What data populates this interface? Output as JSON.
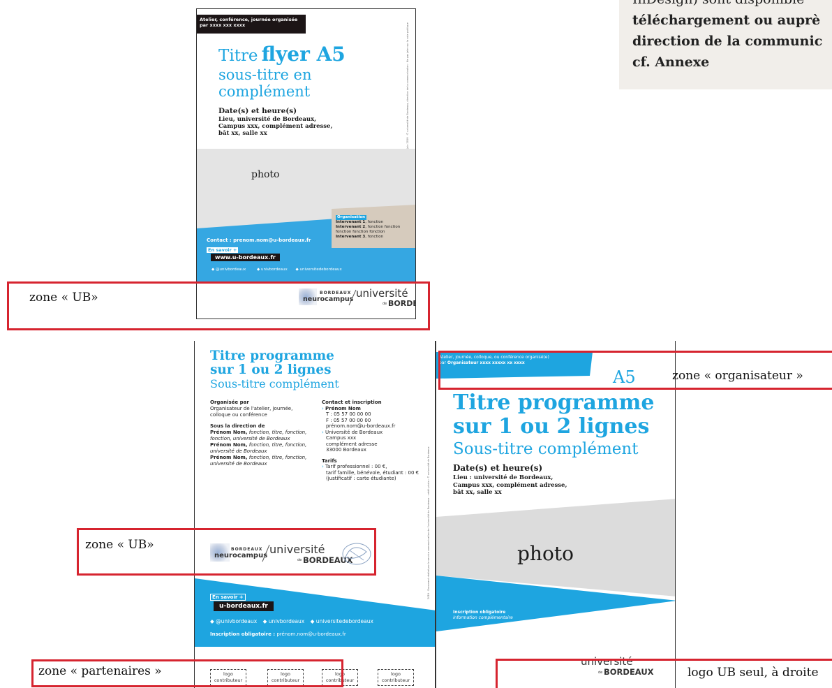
{
  "note": {
    "line1": "InDesign) sont disponible",
    "line2": "téléchargement ou auprè",
    "line3": "direction de la communic",
    "line4": "cf. Annexe"
  },
  "flyer": {
    "tag_line1": "Atelier, conférence, journée organisée",
    "tag_line2": "par xxxx xxx xxxx",
    "title_part1": "Titre",
    "title_part2": "flyer A5",
    "subtitle_line1": "sous-titre en",
    "subtitle_line2": "complément",
    "date": "Date(s) et heure(s)",
    "place_line1": "Lieu, université de Bordeaux,",
    "place_line2": "Campus xxx, complément adresse,",
    "place_line3": "bât xx, salle xx",
    "side_text": "Juin 2019 · © université de Bordeaux, direction de la communication · Ne pas jeter sur la voie publique",
    "photo_label": "photo",
    "org_title": "Organisation",
    "org_line1_bold": "Intervenant 1",
    "org_line1_rest": ", fonction",
    "org_line2_bold": "Intervenant 2",
    "org_line2_rest": ", fonction fonction",
    "org_line3": "fonction fonction fonction",
    "org_line4_bold": "Intervenant 3",
    "org_line4_rest": ", fonction",
    "contact": "Contact : prenom.nom@u-bordeaux.fr",
    "en_savoir": "En savoir +",
    "website": "www.u-bordeaux.fr",
    "social1": "@univbordeaux",
    "social2": "univbordeaux",
    "social3": "universitedebordeaux"
  },
  "logos": {
    "bordeaux_small": "BORDEAUX",
    "neurocampus": "neurocampus",
    "universite": "université",
    "de": "de",
    "bordeaux_big": "BORDEAUX"
  },
  "annotations": {
    "zone_ub_1": "zone « UB»",
    "zone_ub_2": "zone « UB»",
    "zone_partenaires": "zone « partenaires »",
    "zone_organisateur": "zone « organisateur »",
    "logo_ub_seul": "logo UB seul, à droite"
  },
  "programme": {
    "title_line1": "Titre programme",
    "title_line2": "sur 1 ou 2 lignes",
    "subtitle": "Sous-titre complément",
    "organisee_par": "Organisée par",
    "organisateur_line1": "Organisateur de l'atelier, journée,",
    "organisateur_line2": "colloque ou conférence",
    "sous_direction": "Sous la direction de",
    "dir1_name": "Prénom Nom,",
    "dir1_rest": " fonction, titre, fonction,",
    "dir1_line2": "fonction, université de Bordeaux",
    "dir2_name": "Prénom Nom,",
    "dir2_rest": " fonction, titre, fonction,",
    "dir2_line2": "université de Bordeaux",
    "dir3_name": "Prénom Nom,",
    "dir3_rest": " fonction, titre, fonction,",
    "dir3_line2": "université de Bordeaux",
    "contact_title": "Contact et inscription",
    "contact_name": "Prénom Nom",
    "contact_t": "T : 05 57 00 00 00",
    "contact_f": "F : 05 57 00 00 00",
    "contact_mail": "prénom.nom@u-bordeaux.fr",
    "addr1": "Université de Bordeaux",
    "addr2": "Campus xxx",
    "addr3": "complément adresse",
    "addr4": "33000 Bordeaux",
    "tarifs_title": "Tarifs",
    "tarif1": "Tarif professionnel : 00 €,",
    "tarif2": "tarif famille, bénévole, étudiant : 00 €",
    "tarif3": "(justificatif : carte étudiante)",
    "side_text": "2019 · Document réalisé par le service communication de l'université de Bordeaux · crédit photo : © université de Bordeaux",
    "en_savoir": "En savoir +",
    "website": "u-bordeaux.fr",
    "social1": "@univbordeaux",
    "social2": "univbordeaux",
    "social3": "universitedebordeaux",
    "inscription_label": "Inscription obligatoire :",
    "inscription_mail": " prénom.nom@u-bordeaux.fr",
    "logo_contrib_l1": "logo",
    "logo_contrib_l2": "contributeur"
  },
  "a5": {
    "tag_line1": "Atelier, journée, colloque, ou conférence organisé(e)",
    "tag_line2_pre": "par ",
    "tag_line2_bold": "Organisateur xxxx xxxxx xx xxxx",
    "a5_label": "A5",
    "title_line1": "Titre programme",
    "title_line2": "sur 1 ou 2 lignes",
    "subtitle": "Sous-titre complément",
    "date": "Date(s) et heure(s)",
    "place_line1": "Lieu : université de Bordeaux,",
    "place_line2": "Campus xxx, complément adresse,",
    "place_line3": "bât xx, salle xx",
    "photo_label": "photo",
    "inscription": "Inscription obligatoire",
    "info": "information complémentaire"
  },
  "colors": {
    "accent_blue": "#1ea5e0",
    "annotation_red": "#d6242f",
    "dark": "#1c1516",
    "taupe": "#d6cbbd"
  }
}
